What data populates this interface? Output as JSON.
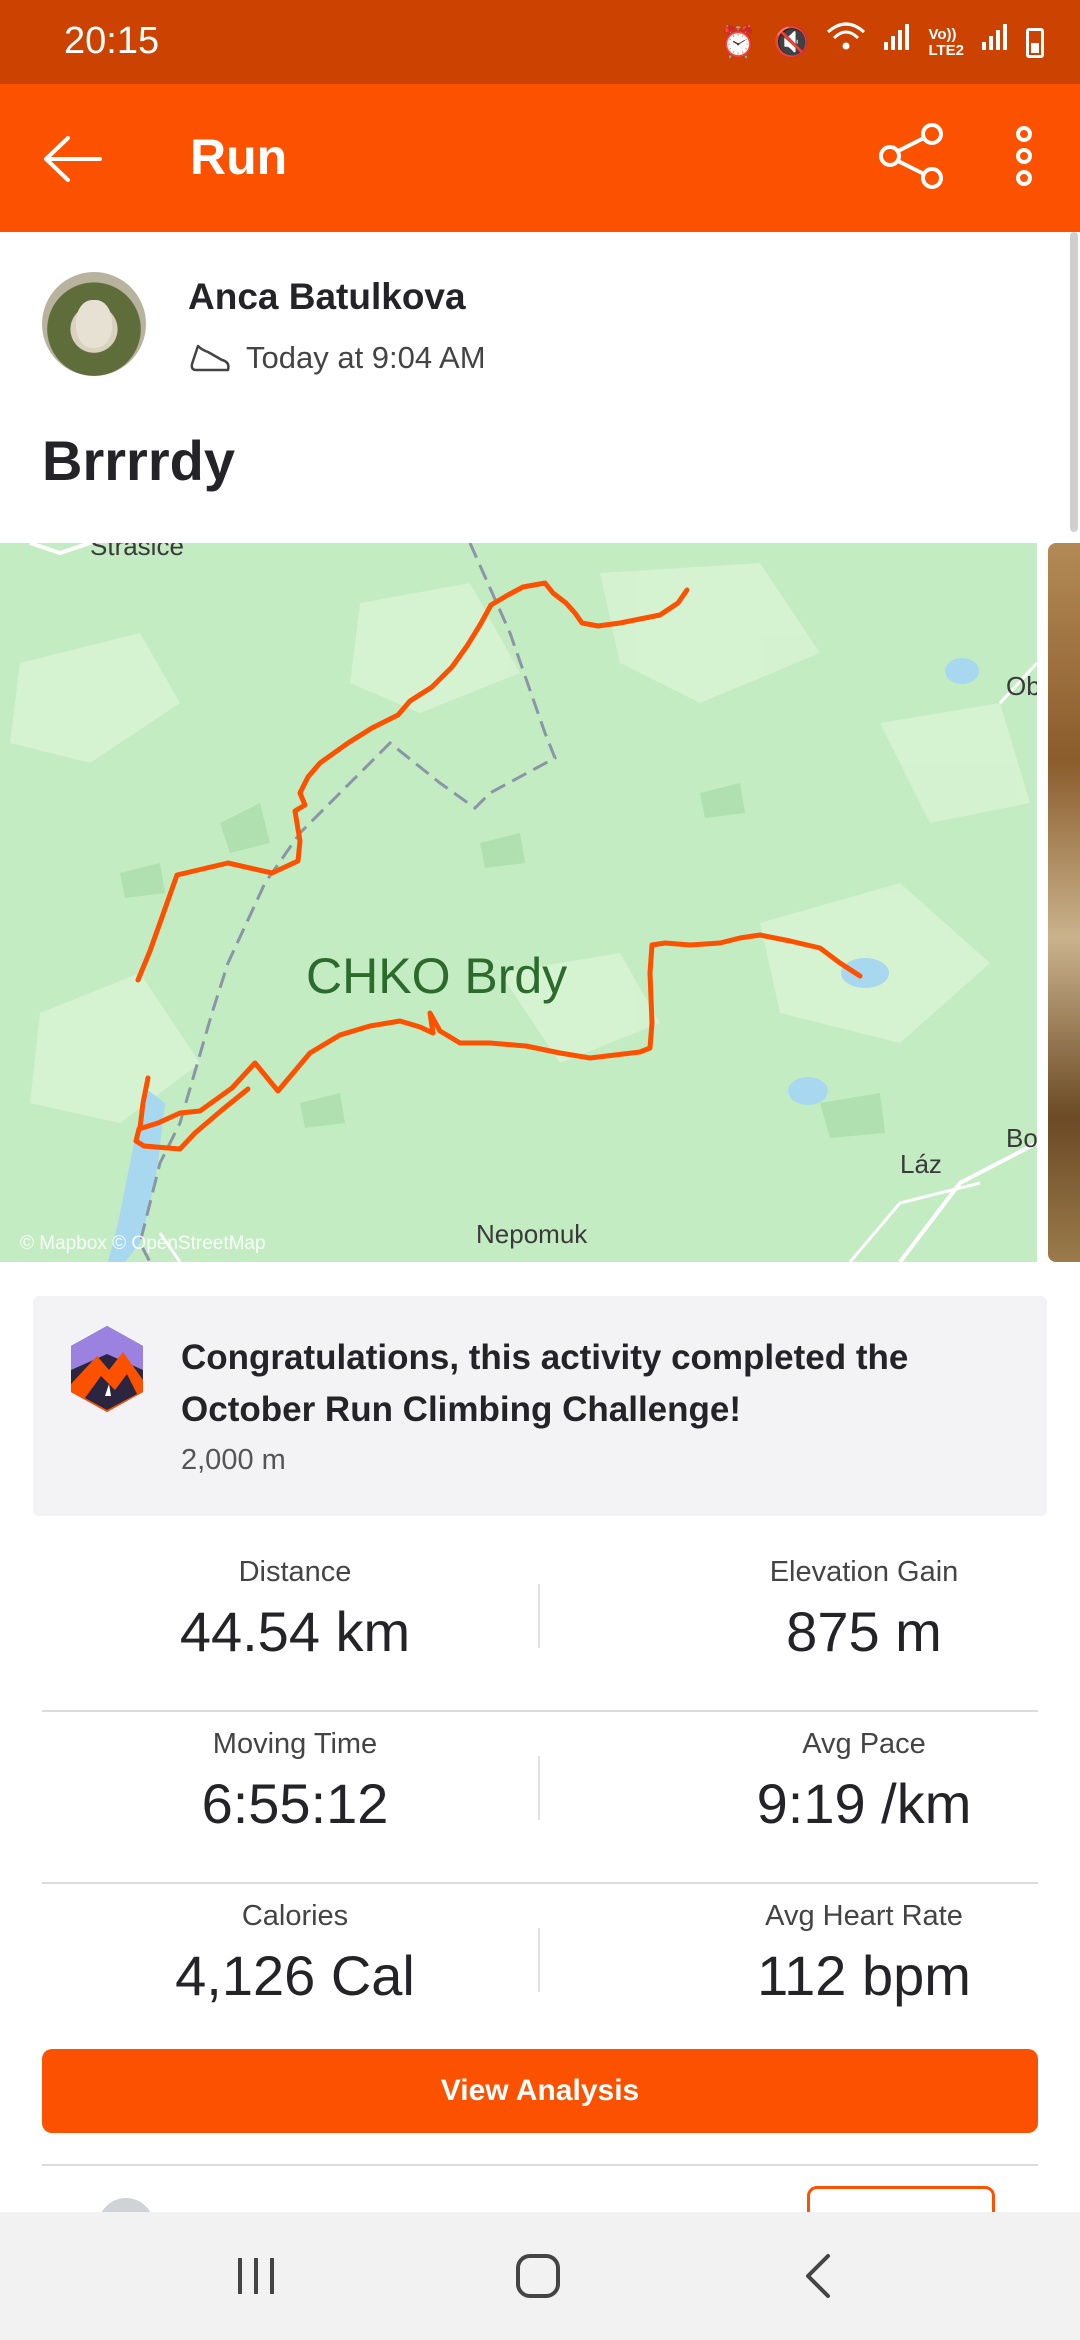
{
  "status_bar": {
    "time": "20:15",
    "volte_label": "Vo))\nLTE2",
    "icons": [
      "alarm-icon",
      "mute-icon",
      "wifi-icon",
      "signal-icon",
      "signal-icon",
      "battery-icon"
    ]
  },
  "app_bar": {
    "title": "Run",
    "icons": [
      "back-arrow-icon",
      "share-icon",
      "more-vertical-icon"
    ]
  },
  "activity": {
    "athlete_name": "Anca Batulkova",
    "time_text": "Today at 9:04 AM",
    "title": "Brrrrdy"
  },
  "map": {
    "labels": {
      "top": "Strasice",
      "right_top": "Ob",
      "park": "CHKO Brdy",
      "laz": "Láz",
      "right_bottom": "Bo",
      "bottom": "Nepomuk"
    },
    "attribution": "© Mapbox © OpenStreetMap",
    "route_color": "#fc5200"
  },
  "challenge": {
    "text": "Congratulations, this activity completed the October Run Climbing Challenge!",
    "sub": "2,000 m"
  },
  "stats": [
    [
      {
        "label": "Distance",
        "value": "44.54 km"
      },
      {
        "label": "Elevation Gain",
        "value": "875 m"
      }
    ],
    [
      {
        "label": "Moving Time",
        "value": "6:55:12"
      },
      {
        "label": "Avg Pace",
        "value": "9:19 /km"
      }
    ],
    [
      {
        "label": "Calories",
        "value": "4,126 Cal"
      },
      {
        "label": "Avg Heart Rate",
        "value": "112 bpm"
      }
    ]
  ],
  "actions": {
    "view_analysis": "View Analysis"
  },
  "colors": {
    "accent": "#fc5200",
    "status_bar": "#cc4200",
    "map_green": "#c3ecc3"
  },
  "nav_bar": {
    "icons": [
      "recent-apps-icon",
      "home-icon",
      "back-icon"
    ]
  }
}
